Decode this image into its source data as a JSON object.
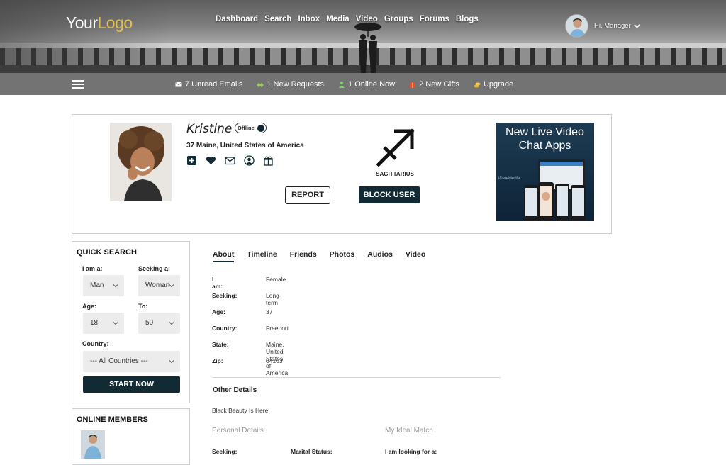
{
  "header": {
    "logo_part1": "Your",
    "logo_part2": "Logo",
    "nav": [
      "Dashboard",
      "Search",
      "Inbox",
      "Media",
      "Video",
      "Groups",
      "Forums",
      "Blogs"
    ],
    "greeting": "Hi, Manager"
  },
  "subbar": {
    "emails": "7 Unread Emails",
    "requests": "1 New Requests",
    "online": "1 Online Now",
    "gifts": "2 New Gifts",
    "upgrade": "Upgrade"
  },
  "profile": {
    "name": "Kristine",
    "status": "Offline",
    "location": "37 Maine, United States of America",
    "report_label": "REPORT",
    "block_label": "BLOCK USER",
    "zodiac": "SAGITTARIUS"
  },
  "ad": {
    "headline_1": "New Live Video",
    "headline_2": "Chat Apps",
    "brand": "iDateMedia"
  },
  "quick_search": {
    "title": "QUICK SEARCH",
    "i_am_label": "I am a:",
    "i_am_value": "Man",
    "seeking_label": "Seeking a:",
    "seeking_value": "Woman",
    "age_label": "Age:",
    "age_value": "18",
    "to_label": "To:",
    "to_value": "50",
    "country_label": "Country:",
    "country_value": "--- All Countries ---",
    "start_label": "START NOW"
  },
  "online_members": {
    "title": "ONLINE MEMBERS"
  },
  "tabs": [
    "About",
    "Timeline",
    "Friends",
    "Photos",
    "Audios",
    "Video"
  ],
  "about": [
    {
      "k": "I am:",
      "v": "Female"
    },
    {
      "k": "Seeking:",
      "v": "Long-term"
    },
    {
      "k": "Age:",
      "v": "37"
    },
    {
      "k": "Country:",
      "v": "Freeport"
    },
    {
      "k": "State:",
      "v": "Maine, United States of America"
    },
    {
      "k": "Zip:",
      "v": "04103"
    }
  ],
  "other": {
    "title": "Other Details",
    "tagline": "Black Beauty Is Here!",
    "personal_details": "Personal Details",
    "ideal_match": "My Ideal Match",
    "seeking": "Seeking:",
    "marital_status": "Marital Status:",
    "looking_for": "I am looking for a:"
  },
  "colors": {
    "accent_dark": "#112a33",
    "subbar": "#737373",
    "logo_gold": "#e3c04a"
  }
}
